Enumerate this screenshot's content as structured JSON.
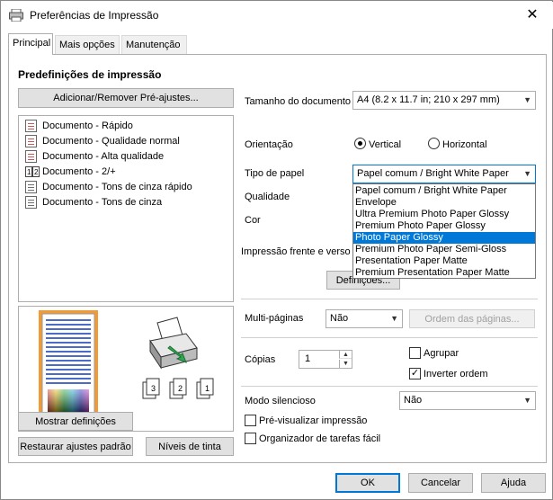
{
  "window": {
    "title": "Preferências de Impressão",
    "close": "✕"
  },
  "tabs": [
    {
      "label": "Principal"
    },
    {
      "label": "Mais opções"
    },
    {
      "label": "Manutenção"
    }
  ],
  "presets": {
    "heading": "Predefinições de impressão",
    "add_remove_button": "Adicionar/Remover Pré-ajustes...",
    "items": [
      {
        "label": "Documento - Rápido"
      },
      {
        "label": "Documento - Qualidade normal"
      },
      {
        "label": "Documento - Alta qualidade"
      },
      {
        "label": "Documento - 2/+"
      },
      {
        "label": "Documento - Tons de cinza rápido"
      },
      {
        "label": "Documento - Tons de cinza"
      }
    ]
  },
  "preview": {
    "copy_numbers": [
      "3",
      "2",
      "1"
    ]
  },
  "settings": {
    "doc_size_label": "Tamanho do documento",
    "doc_size_value": "A4 (8.2 x 11.7 in; 210 x 297 mm)",
    "orientation_label": "Orientação",
    "orientation_vertical": "Vertical",
    "orientation_horizontal": "Horizontal",
    "paper_type_label": "Tipo de papel",
    "paper_type_value": "Papel comum / Bright White Paper",
    "quality_label": "Qualidade",
    "color_label": "Cor",
    "duplex_label": "Impressão frente e verso",
    "duplex_settings_button": "Definições...",
    "multipage_label": "Multi-páginas",
    "multipage_value": "Não",
    "page_order_button": "Ordem das páginas...",
    "copies_label": "Cópias",
    "copies_value": "1",
    "collate_label": "Agrupar",
    "reverse_order_label": "Inverter ordem",
    "quiet_mode_label": "Modo silencioso",
    "quiet_mode_value": "Não",
    "preview_print_label": "Pré-visualizar impressão",
    "job_arranger_label": "Organizador de tarefas fácil"
  },
  "paper_dropdown": {
    "options": [
      "Papel comum / Bright White Paper",
      "Envelope",
      "Ultra Premium Photo Paper Glossy",
      "Premium Photo Paper Glossy",
      "Photo Paper Glossy",
      "Premium Photo Paper Semi-Gloss",
      "Presentation Paper Matte",
      "Premium Presentation Paper Matte"
    ],
    "highlighted": "Photo Paper Glossy"
  },
  "left_buttons": {
    "show_settings": "Mostrar definições",
    "restore_defaults": "Restaurar ajustes padrão",
    "ink_levels": "Níveis de tinta"
  },
  "footer": {
    "ok": "OK",
    "cancel": "Cancelar",
    "help": "Ajuda"
  },
  "colors": {
    "accent": "#0078d7"
  }
}
